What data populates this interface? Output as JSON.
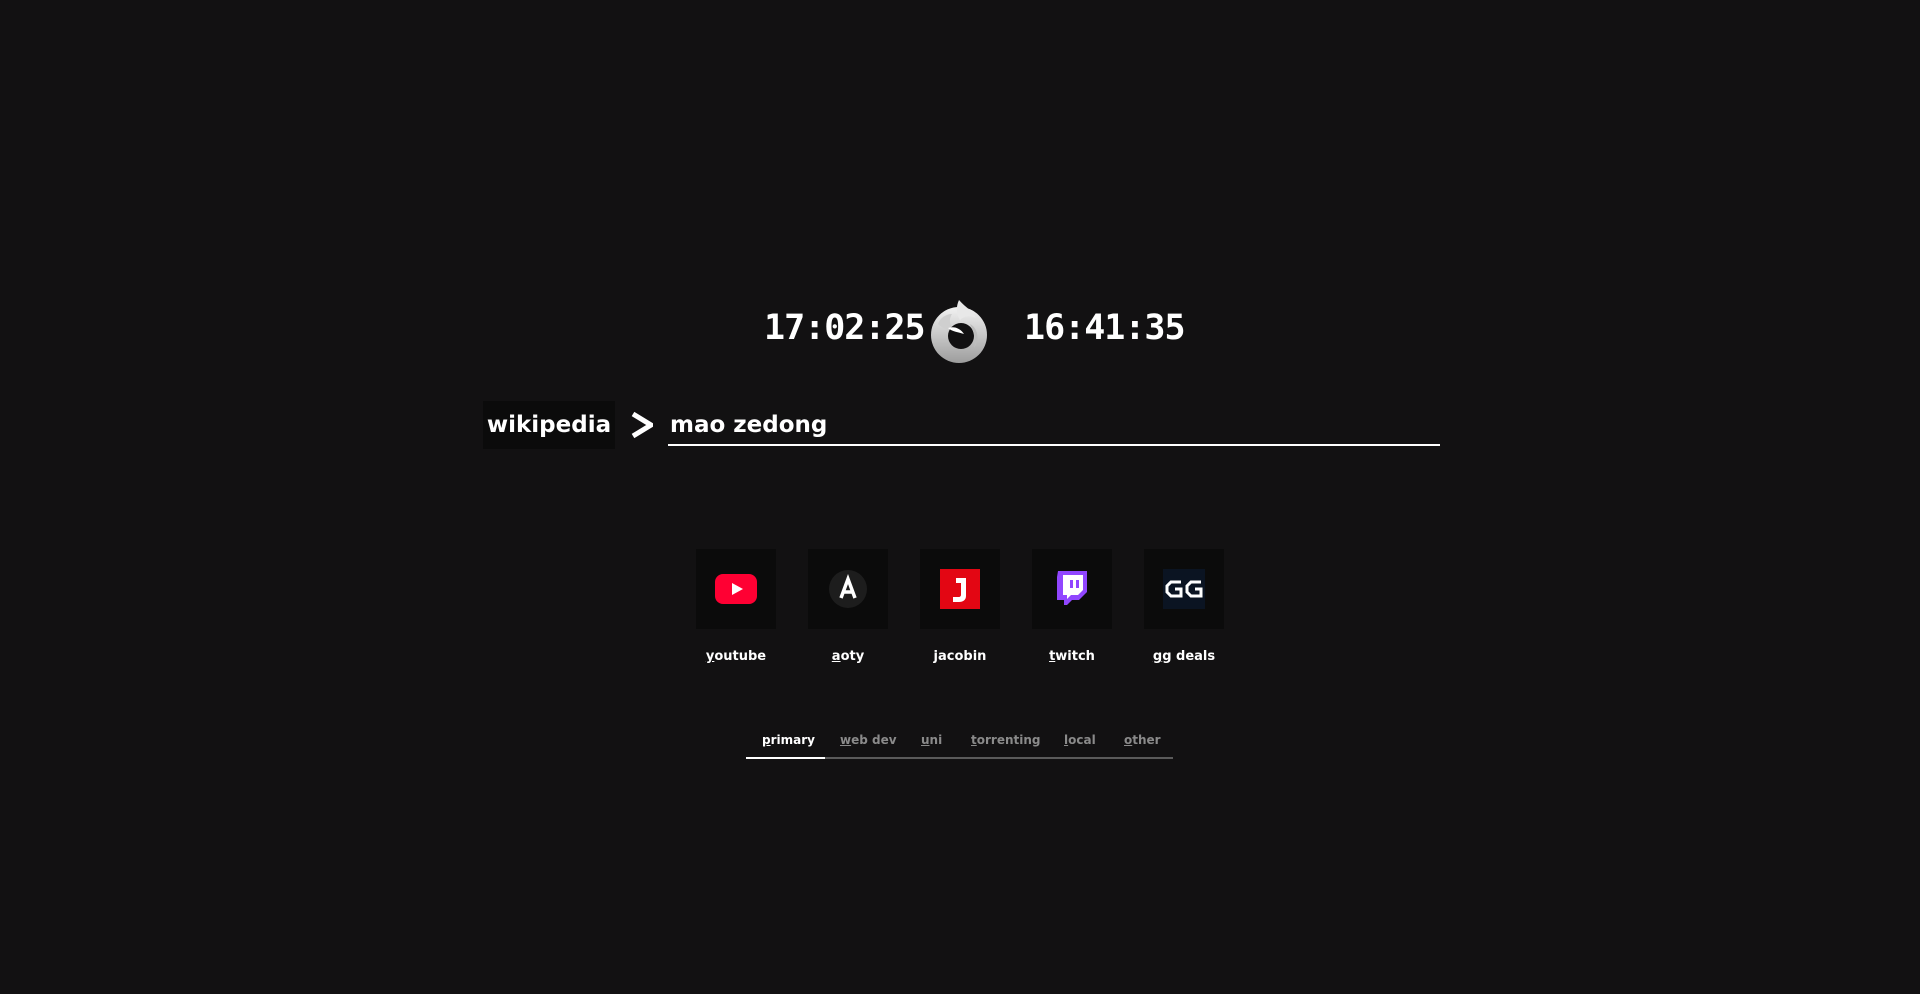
{
  "clocks": {
    "left": "17:02:25",
    "right": "16:41:35"
  },
  "logo": {
    "icon": "browser-logo-icon",
    "color": "#d9d9d9"
  },
  "search": {
    "engine": "wikipedia",
    "prompt_icon": "chevron-right-icon",
    "query": "mao zedong"
  },
  "bookmarks": [
    {
      "label_key": "y",
      "label_rest": "outube",
      "icon": "youtube-icon",
      "color": "#ff0033"
    },
    {
      "label_key": "a",
      "label_rest": "oty",
      "icon": "aoty-icon",
      "color": "#1d1d1d"
    },
    {
      "label_key": "j",
      "label_rest": "acobin",
      "icon": "jacobin-icon",
      "color": "#e30613"
    },
    {
      "label_key": "t",
      "label_rest": "witch",
      "icon": "twitch-icon",
      "color": "#9146ff"
    },
    {
      "label_key": "g",
      "label_rest": "g deals",
      "icon": "gg-deals-icon",
      "color": "#0b1422"
    }
  ],
  "tabs": [
    {
      "label_key": "p",
      "label_rest": "rimary",
      "active": true
    },
    {
      "label_key": "w",
      "label_rest": "eb dev",
      "active": false
    },
    {
      "label_key": "u",
      "label_rest": "ni",
      "active": false
    },
    {
      "label_key": "t",
      "label_rest": "orrenting",
      "active": false
    },
    {
      "label_key": "l",
      "label_rest": "ocal",
      "active": false
    },
    {
      "label_key": "o",
      "label_rest": "ther",
      "active": false
    }
  ],
  "theme": {
    "background": "#121112",
    "tile": "#0b0b0b",
    "text": "#ffffff",
    "muted": "#8a8a8a"
  }
}
